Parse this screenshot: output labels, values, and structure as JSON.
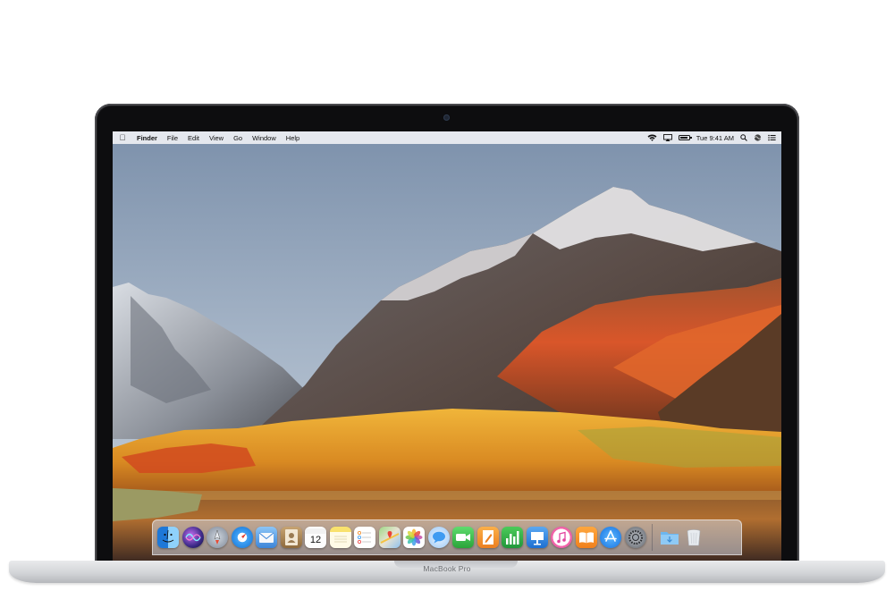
{
  "device": {
    "model_label": "MacBook Pro"
  },
  "menubar": {
    "app_name": "Finder",
    "menus": [
      "File",
      "Edit",
      "View",
      "Go",
      "Window",
      "Help"
    ],
    "clock": "Tue 9:41 AM",
    "status_icons": [
      "wifi-icon",
      "airplay-icon",
      "battery-icon",
      "spotlight-icon",
      "siri-icon",
      "notification-center-icon"
    ]
  },
  "desktop": {
    "wallpaper": "macOS High Sierra mountains with autumn foliage"
  },
  "dock": {
    "apps": [
      {
        "name": "Finder",
        "icon": "finder-icon",
        "color": "#2f8ce6",
        "running": true
      },
      {
        "name": "Siri",
        "icon": "siri-icon",
        "color": "#3a2a6b"
      },
      {
        "name": "Launchpad",
        "icon": "launchpad-icon",
        "color": "#9aa4b3"
      },
      {
        "name": "Safari",
        "icon": "safari-icon",
        "color": "#1f8ef1"
      },
      {
        "name": "Mail",
        "icon": "mail-icon",
        "color": "#5b9fe8"
      },
      {
        "name": "Contacts",
        "icon": "contacts-icon",
        "color": "#b8925c"
      },
      {
        "name": "Calendar",
        "icon": "calendar-icon",
        "color": "#ffffff",
        "day": "12"
      },
      {
        "name": "Notes",
        "icon": "notes-icon",
        "color": "#f7d54a"
      },
      {
        "name": "Reminders",
        "icon": "reminders-icon",
        "color": "#ffffff"
      },
      {
        "name": "Maps",
        "icon": "maps-icon",
        "color": "#7fbf6a"
      },
      {
        "name": "Photos",
        "icon": "photos-icon",
        "color": "#ffffff"
      },
      {
        "name": "Messages",
        "icon": "messages-icon",
        "color": "#4fa6f5"
      },
      {
        "name": "FaceTime",
        "icon": "facetime-icon",
        "color": "#3ec64f"
      },
      {
        "name": "Pages",
        "icon": "pages-icon",
        "color": "#f29a35"
      },
      {
        "name": "Numbers",
        "icon": "numbers-icon",
        "color": "#2fb344"
      },
      {
        "name": "Keynote",
        "icon": "keynote-icon",
        "color": "#2a82e4"
      },
      {
        "name": "iTunes",
        "icon": "itunes-icon",
        "color": "#f45ea4"
      },
      {
        "name": "iBooks",
        "icon": "ibooks-icon",
        "color": "#f5922a"
      },
      {
        "name": "App Store",
        "icon": "app-store-icon",
        "color": "#2a8ff0"
      },
      {
        "name": "System Preferences",
        "icon": "system-preferences-icon",
        "color": "#8c8f96"
      }
    ],
    "stacks": [
      {
        "name": "Downloads",
        "icon": "downloads-folder-icon",
        "color": "#6cb6ef"
      },
      {
        "name": "Trash",
        "icon": "trash-icon",
        "color": "#dfe3e8"
      }
    ]
  }
}
